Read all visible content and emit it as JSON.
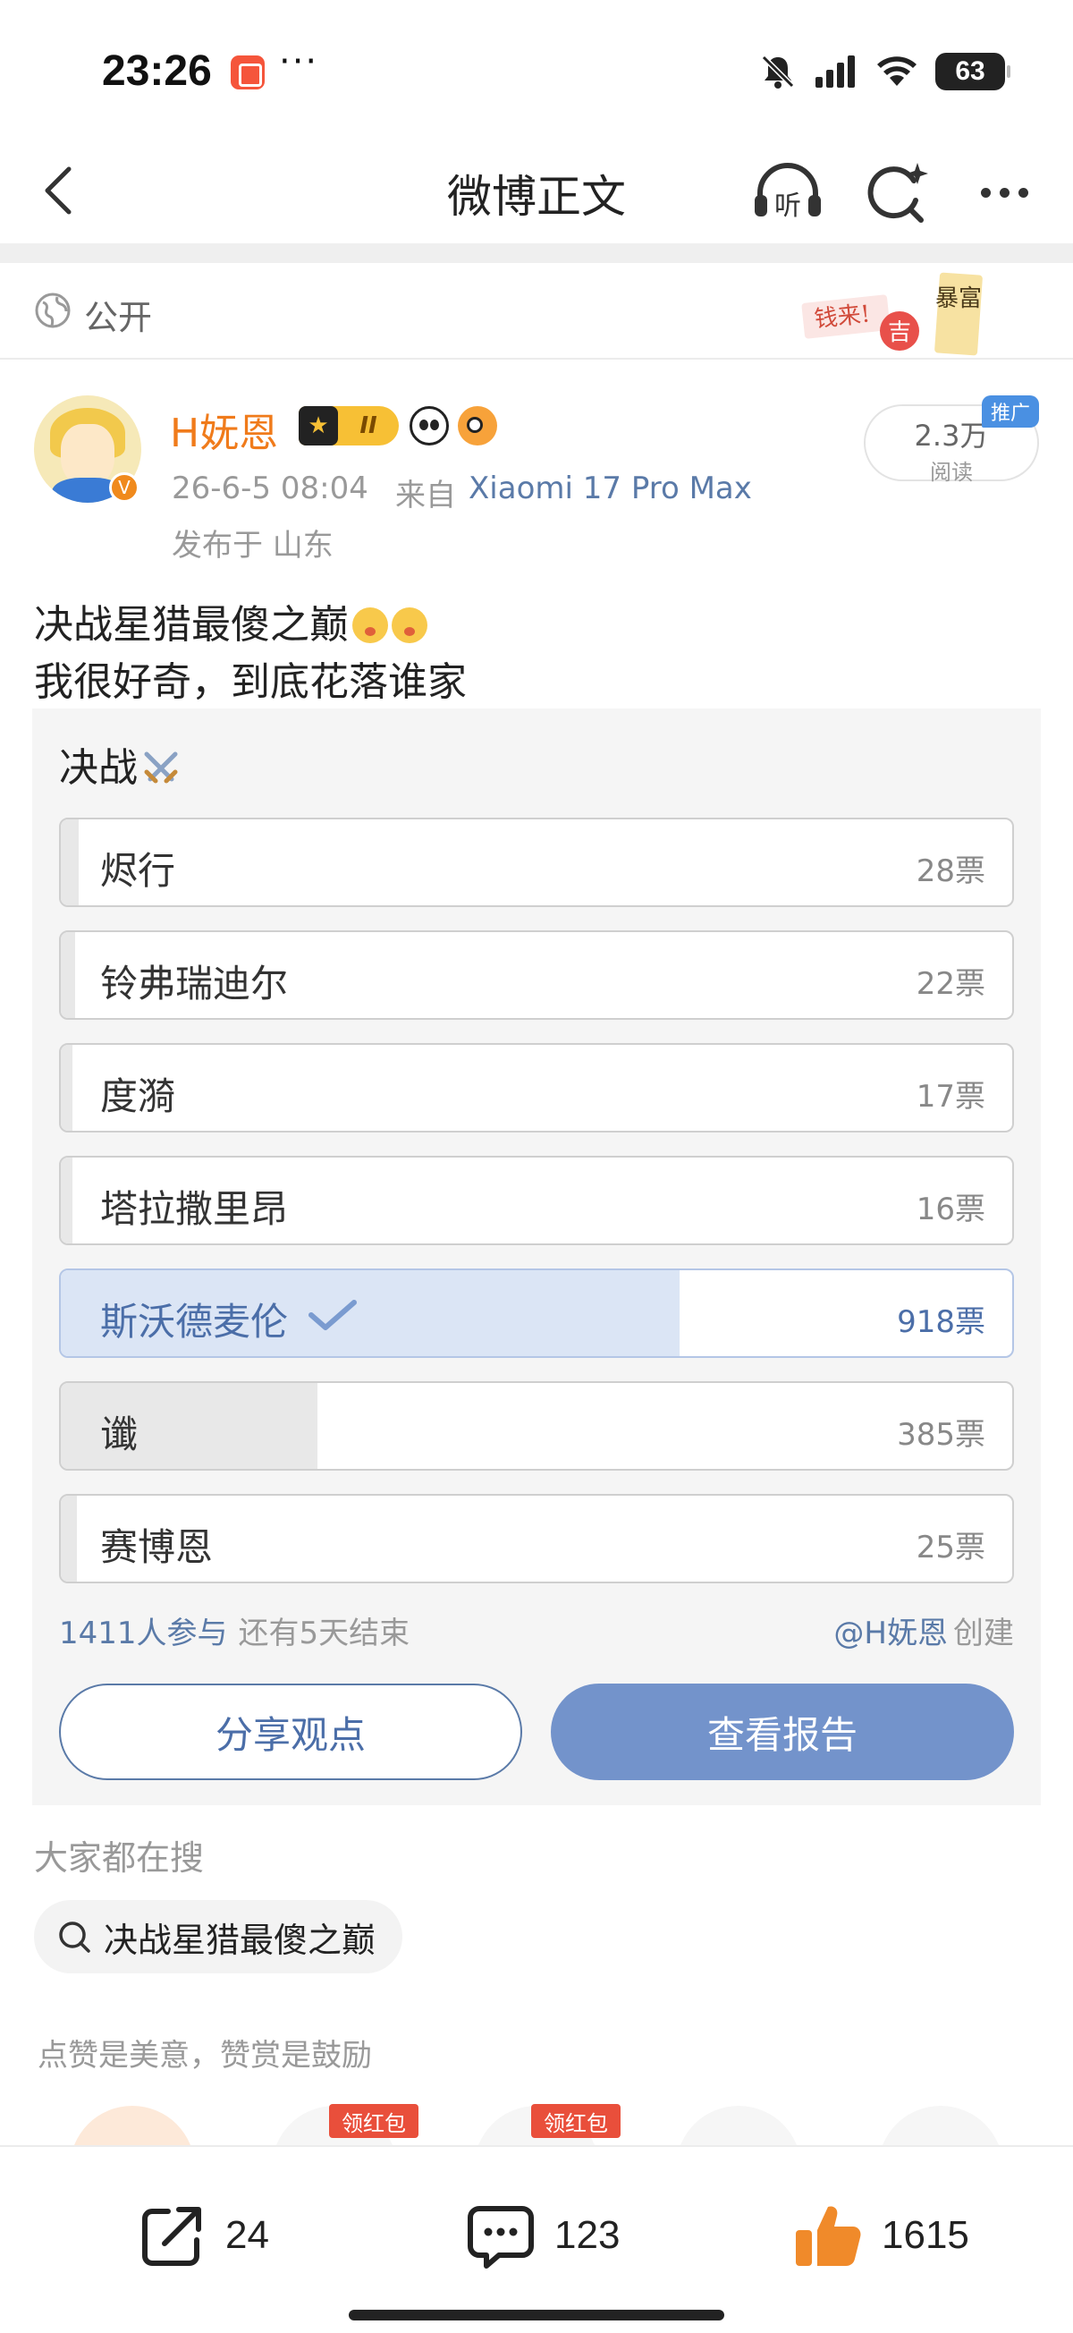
{
  "status_bar": {
    "time": "23:26",
    "dots": "···",
    "battery": "63",
    "icons": [
      "app-notification-icon",
      "mute-bell-icon",
      "signal-icon",
      "wifi-icon",
      "battery-icon"
    ]
  },
  "nav": {
    "title": "微博正文",
    "listen_label": "听",
    "icons": [
      "back-arrow-icon",
      "headphones-listen-icon",
      "search-sparkle-icon",
      "more-dots-icon"
    ]
  },
  "visibility": {
    "label": "公开",
    "sticker_text": [
      "钱来!",
      "吉",
      "暴富"
    ]
  },
  "author": {
    "name": "H妩恩",
    "rank": "II",
    "post_time": "26-6-5 08:04",
    "from_label": "来自",
    "device": "Xiaomi 17 Pro Max",
    "location": "发布于 山东",
    "reads_count": "2.3万",
    "reads_label": "阅读",
    "promo_tag": "推广"
  },
  "content": {
    "line1": "决战星猎最傻之巅",
    "line2": "我很好奇，到底花落谁家"
  },
  "poll": {
    "title": "决战",
    "options": [
      {
        "label": "烬行",
        "votes": "28票",
        "share": 0.019,
        "selected": false
      },
      {
        "label": "铃弗瑞迪尔",
        "votes": "22票",
        "share": 0.015,
        "selected": false
      },
      {
        "label": "度漪",
        "votes": "17票",
        "share": 0.012,
        "selected": false
      },
      {
        "label": "塔拉撒里昂",
        "votes": "16票",
        "share": 0.011,
        "selected": false
      },
      {
        "label": "斯沃德麦伦",
        "votes": "918票",
        "share": 0.65,
        "selected": true
      },
      {
        "label": "谶",
        "votes": "385票",
        "share": 0.27,
        "selected": false
      },
      {
        "label": "赛博恩",
        "votes": "25票",
        "share": 0.017,
        "selected": false
      }
    ],
    "participants": "1411人参与",
    "deadline": "还有5天结束",
    "creator": "@H妩恩",
    "created_label": "创建",
    "share_button": "分享观点",
    "report_button": "查看报告"
  },
  "trending": {
    "label": "大家都在搜",
    "query": "决战星猎最傻之巅"
  },
  "reward": {
    "label": "点赞是美意，赞赏是鼓励",
    "tags": [
      "领红包",
      "领红包"
    ]
  },
  "actions": {
    "repost": "24",
    "comment": "123",
    "like": "1615"
  }
}
